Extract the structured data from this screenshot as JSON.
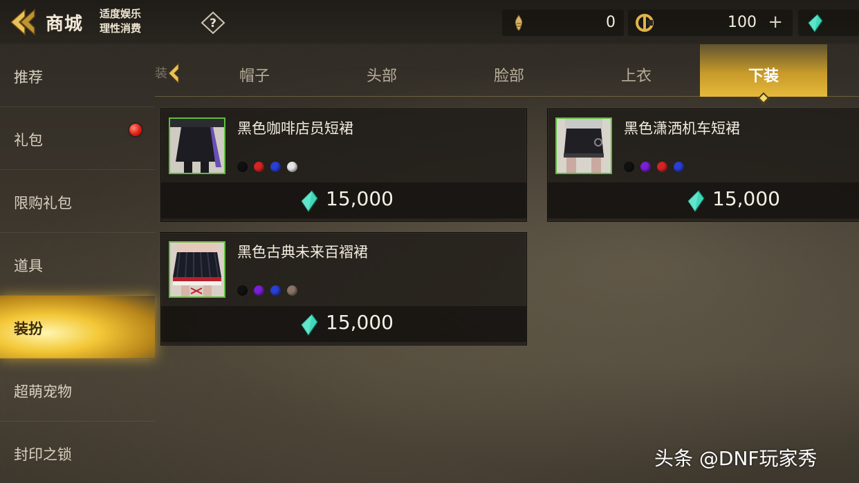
{
  "header": {
    "title": "商城",
    "slogan_line1": "适度娱乐",
    "slogan_line2": "理性消费",
    "help_symbol": "?",
    "currencies": [
      {
        "icon": "gold-flame-icon",
        "value": "0"
      },
      {
        "icon": "coin-icon",
        "value": "100"
      },
      {
        "icon": "gem-icon",
        "value": ""
      }
    ],
    "plus_symbol": "+"
  },
  "sidebar": {
    "items": [
      {
        "label": "推荐"
      },
      {
        "label": "礼包"
      },
      {
        "label": "限购礼包"
      },
      {
        "label": "道具"
      },
      {
        "label": "装扮"
      },
      {
        "label": "超萌宠物"
      },
      {
        "label": "封印之锁"
      }
    ],
    "active_index": 4
  },
  "tabs": {
    "cutoff_left": "装",
    "items": [
      {
        "label": "帽子"
      },
      {
        "label": "头部"
      },
      {
        "label": "脸部"
      },
      {
        "label": "上衣"
      },
      {
        "label": "下装"
      }
    ],
    "active_index": 4
  },
  "items": [
    {
      "name": "黑色咖啡店员短裙",
      "price": "15,000",
      "colors": [
        "#111111",
        "#d42424",
        "#2a3fd6",
        "#e6e6e6"
      ]
    },
    {
      "name": "黑色潇洒机车短裙",
      "price": "15,000",
      "colors": [
        "#111111",
        "#7b1fd6",
        "#d42424",
        "#2a3fd6"
      ]
    },
    {
      "name": "黑色古典未来百褶裙",
      "price": "15,000",
      "colors": [
        "#111111",
        "#7b1fd6",
        "#2a3fd6",
        "#8a7468"
      ]
    }
  ],
  "watermark": "头条 @DNF玩家秀",
  "colors": {
    "accent_gold": "#e6b93c",
    "gem_teal": "#3fd8b8",
    "thumb_border_green": "#5cbf3b",
    "badge_red": "#e01d12"
  }
}
